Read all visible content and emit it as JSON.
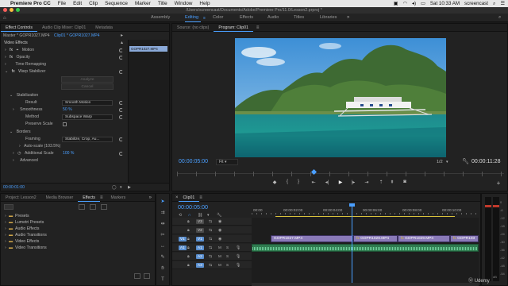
{
  "menubar": {
    "apple": "",
    "items": [
      "Premiere Pro CC",
      "File",
      "Edit",
      "Clip",
      "Sequence",
      "Marker",
      "Title",
      "Window",
      "Help"
    ],
    "clock": "Sat 10:33 AM",
    "user": "screencast"
  },
  "window": {
    "title": "/Users/screencast/Documents/Adobe/Premiere Pro/11.0/Lesson2.prproj *"
  },
  "workspaces": {
    "items": [
      "Assembly",
      "Editing",
      "Color",
      "Effects",
      "Audio",
      "Titles",
      "Libraries"
    ],
    "active": "Editing"
  },
  "effect_controls": {
    "tabs": [
      "Effect Controls",
      "Audio Clip Mixer: Clip01",
      "Metadata"
    ],
    "master_label": "Master * GOPR1027.MP4",
    "clip_label": "Clip01 * GOPR1027.MP4",
    "timeline_clip_name": "GOPR1027.MP4",
    "section_video": "Video Effects",
    "rows": {
      "motion": "Motion",
      "opacity": "Opacity",
      "time_remap": "Time Remapping",
      "warp": "Warp Stabilizer",
      "analyze": "Analyze",
      "cancel": "Cancel",
      "stabilization": "Stabilization",
      "result_label": "Result",
      "result_value": "Smooth Motion",
      "smoothness_label": "Smoothness",
      "smoothness_value": "50 %",
      "method_label": "Method",
      "method_value": "Subspace Warp",
      "preserve_label": "Preserve Scale",
      "borders": "Borders",
      "framing_label": "Framing",
      "framing_value": "Stabilize, Crop, Au...",
      "autoscale_label": "Auto-scale (103.5%)",
      "addscale_label": "Additional Scale",
      "addscale_value": "100 %",
      "advanced": "Advanced"
    },
    "timecode": "00:00:01:00"
  },
  "source_monitor": {
    "tabs": [
      "Source: (no clips)",
      "Program: Clip01"
    ]
  },
  "program": {
    "timecode": "00:00:05:00",
    "fit": "Fit",
    "fraction": "1/2",
    "duration": "00:00:11:28"
  },
  "project": {
    "tabs": [
      "Project: Lesson2",
      "Media Browser",
      "Effects",
      "Markers"
    ],
    "folders": [
      "Presets",
      "Lumetri Presets",
      "Audio Effects",
      "Audio Transitions",
      "Video Effects",
      "Video Transitions"
    ]
  },
  "timeline": {
    "tab": "Clip01",
    "timecode": "00:00:05:00",
    "ruler": [
      "00:00",
      "00:00:02:00",
      "00:00:04:00",
      "00:00:06:00",
      "00:00:08:00",
      "00:00:10:00"
    ],
    "video_tracks": [
      "V3",
      "V2",
      "V1"
    ],
    "audio_tracks": [
      "A1",
      "A2",
      "A3"
    ],
    "video_clips": [
      "GOPR1027.MP4",
      "GOPR1028.MP4",
      "GOPR1029.MP4",
      "GOPR103"
    ]
  },
  "meters": {
    "labels": [
      "0",
      "-6",
      "-12",
      "-18",
      "-24",
      "-30",
      "-36",
      "-42",
      "-48",
      "-54",
      "dB"
    ]
  },
  "watermark": "Udemy",
  "colors": {
    "accent": "#4a9fff",
    "video_clip": "#8a7ab8",
    "audio_clip": "#2f7a4f"
  }
}
